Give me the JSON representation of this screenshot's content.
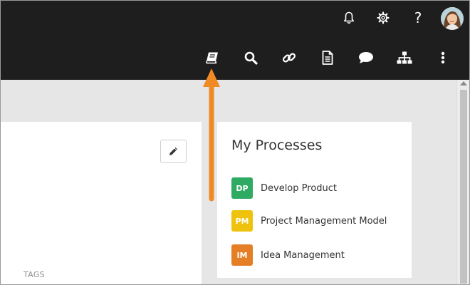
{
  "topbar": {
    "icons_top": [
      "bell-icon",
      "gear-icon",
      "help-icon"
    ],
    "help_glyph": "?",
    "icons_toolbar": [
      "book-icon",
      "search-icon",
      "link-icon",
      "document-icon",
      "comment-icon",
      "hierarchy-icon",
      "more-icon"
    ]
  },
  "left_panel": {
    "tags_label": "TAGS"
  },
  "processes": {
    "title": "My Processes",
    "items": [
      {
        "abbr": "DP",
        "name": "Develop Product",
        "color": "#2eaa63"
      },
      {
        "abbr": "PM",
        "name": "Project Management Model",
        "color": "#efc20d"
      },
      {
        "abbr": "IM",
        "name": "Idea Management",
        "color": "#e47f26"
      }
    ]
  },
  "colors": {
    "topbar": "#1e1e1e",
    "background": "#e6e6e6",
    "highlight_arrow": "#f08a24"
  }
}
